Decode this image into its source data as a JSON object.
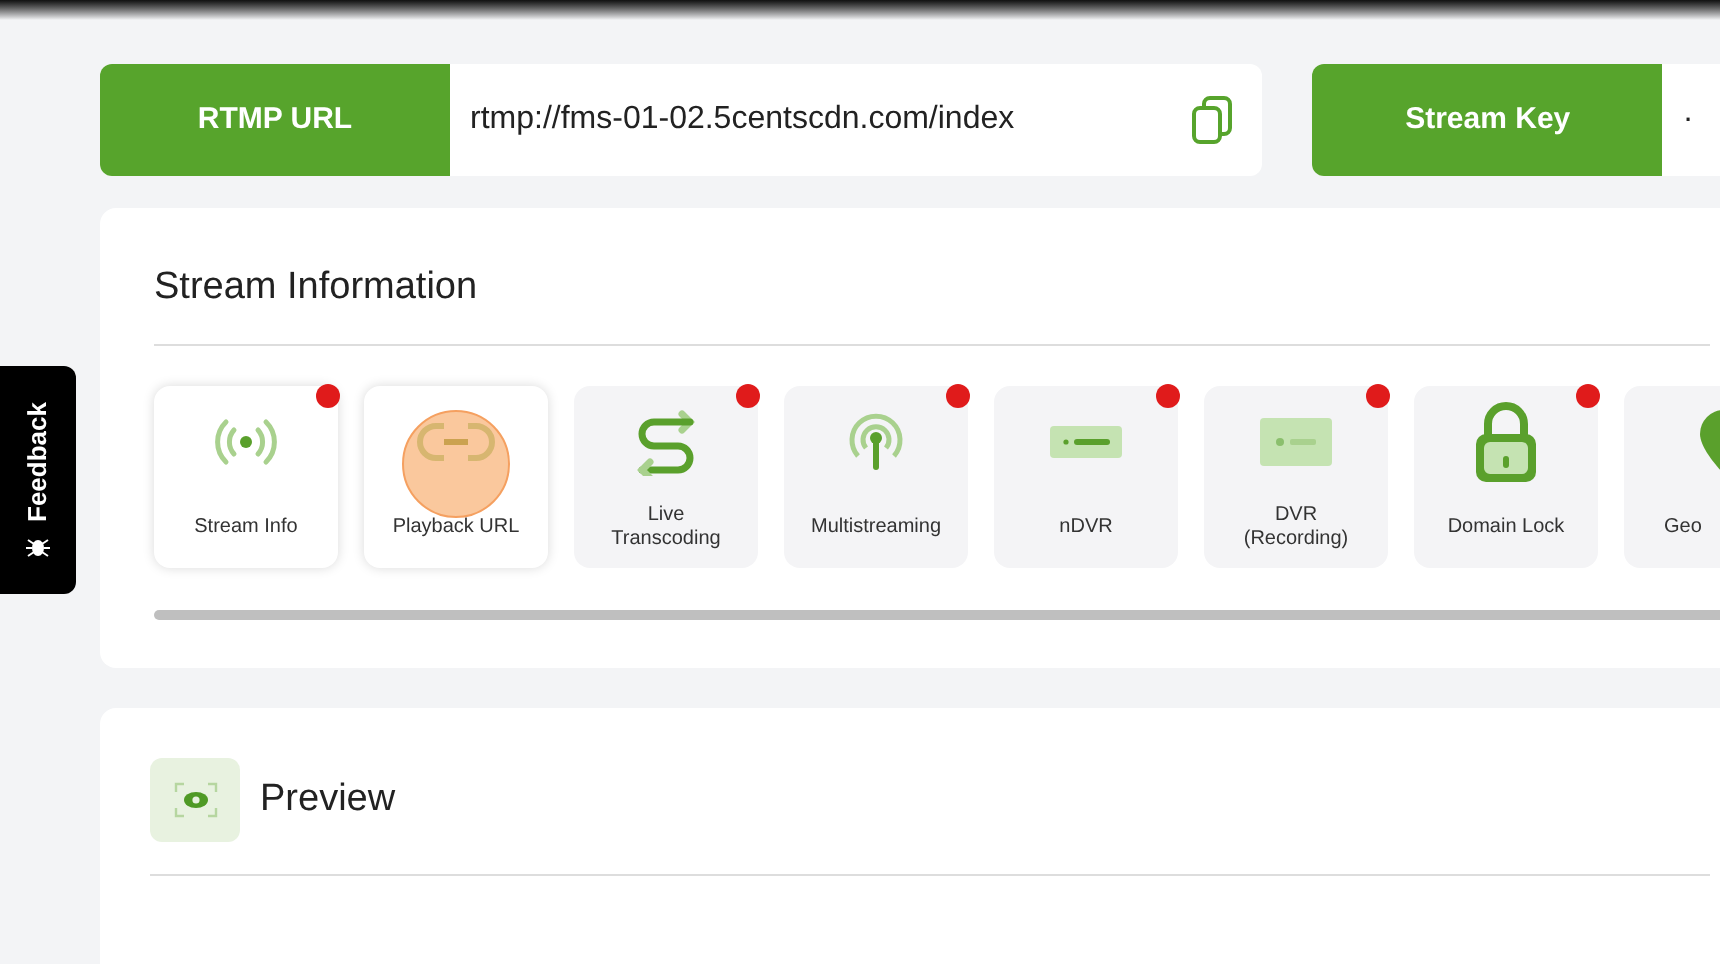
{
  "credentials": [
    {
      "label": "RTMP URL",
      "value": "rtmp://fms-01-02.5centscdn.com/index",
      "copyable": true
    },
    {
      "label": "Stream Key",
      "value": "·",
      "copyable": false
    }
  ],
  "stream_information": {
    "title": "Stream Information",
    "tiles": [
      {
        "label": "Stream Info",
        "kind": "broadcast",
        "selected": true,
        "badge": true
      },
      {
        "label": "Playback URL",
        "kind": "link",
        "selected": true,
        "badge": false
      },
      {
        "label": "Live\nTranscoding",
        "kind": "transcode",
        "selected": false,
        "badge": true
      },
      {
        "label": "Multistreaming",
        "kind": "antenna",
        "selected": false,
        "badge": true
      },
      {
        "label": "nDVR",
        "kind": "ndvr",
        "selected": false,
        "badge": true
      },
      {
        "label": "DVR\n(Recording)",
        "kind": "rec",
        "selected": false,
        "badge": true
      },
      {
        "label": "Domain Lock",
        "kind": "lock",
        "selected": false,
        "badge": true
      },
      {
        "label": "Geo",
        "kind": "pin",
        "selected": false,
        "badge": false
      }
    ]
  },
  "preview": {
    "title": "Preview"
  },
  "feedback_tab": {
    "label": "Feedback"
  }
}
